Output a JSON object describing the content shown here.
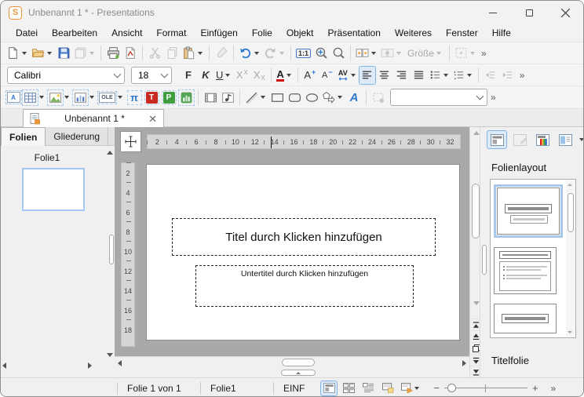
{
  "window": {
    "app_badge": "S",
    "title": "Unbenannt 1 * - Presentations"
  },
  "menu": {
    "items": [
      "Datei",
      "Bearbeiten",
      "Ansicht",
      "Format",
      "Einfügen",
      "Folie",
      "Objekt",
      "Präsentation",
      "Weiteres",
      "Fenster",
      "Hilfe"
    ]
  },
  "toolbars": {
    "standard": {
      "zoom_original": "1:1",
      "size_button": "Größe"
    },
    "format": {
      "font_name": "Calibri",
      "font_size": "18",
      "bold": "F",
      "italic": "K",
      "underline": "U",
      "superscript": "X",
      "subscript": "X",
      "font_color": "A",
      "grow_font": "A",
      "shrink_font": "A",
      "spacing": "AV"
    },
    "objects": {
      "textframe": "A",
      "ole": "OLE",
      "formula": "π",
      "textmaker": "T",
      "planmaker": "P",
      "textart": "A",
      "object_selector_value": ""
    }
  },
  "tabbar": {
    "tab_label": "Unbenannt 1 *"
  },
  "left_panel": {
    "folien_tab": "Folien",
    "gliederung_tab": "Gliederung",
    "slide_name": "Folie1"
  },
  "ruler": {
    "horizontal": [
      "2",
      "4",
      "6",
      "8",
      "10",
      "12",
      "14",
      "16",
      "18",
      "20",
      "22",
      "24",
      "26",
      "28",
      "30",
      "32"
    ],
    "vertical": [
      "2",
      "4",
      "6",
      "8",
      "10",
      "12",
      "14",
      "16",
      "18"
    ]
  },
  "slide": {
    "title_placeholder": "Titel durch Klicken hinzufügen",
    "subtitle_placeholder": "Untertitel durch Klicken hinzufügen"
  },
  "right_panel": {
    "title": "Folienlayout",
    "selected_layout": "Titelfolie"
  },
  "statusbar": {
    "slide_position": "Folie 1 von 1",
    "slide_name": "Folie1",
    "insert_mode": "EINF"
  },
  "colors": {
    "accent_border": "#82b3e4",
    "accent_fill": "#ddeafa",
    "canvas": "#a9a9a9",
    "app_orange": "#e8963c"
  }
}
